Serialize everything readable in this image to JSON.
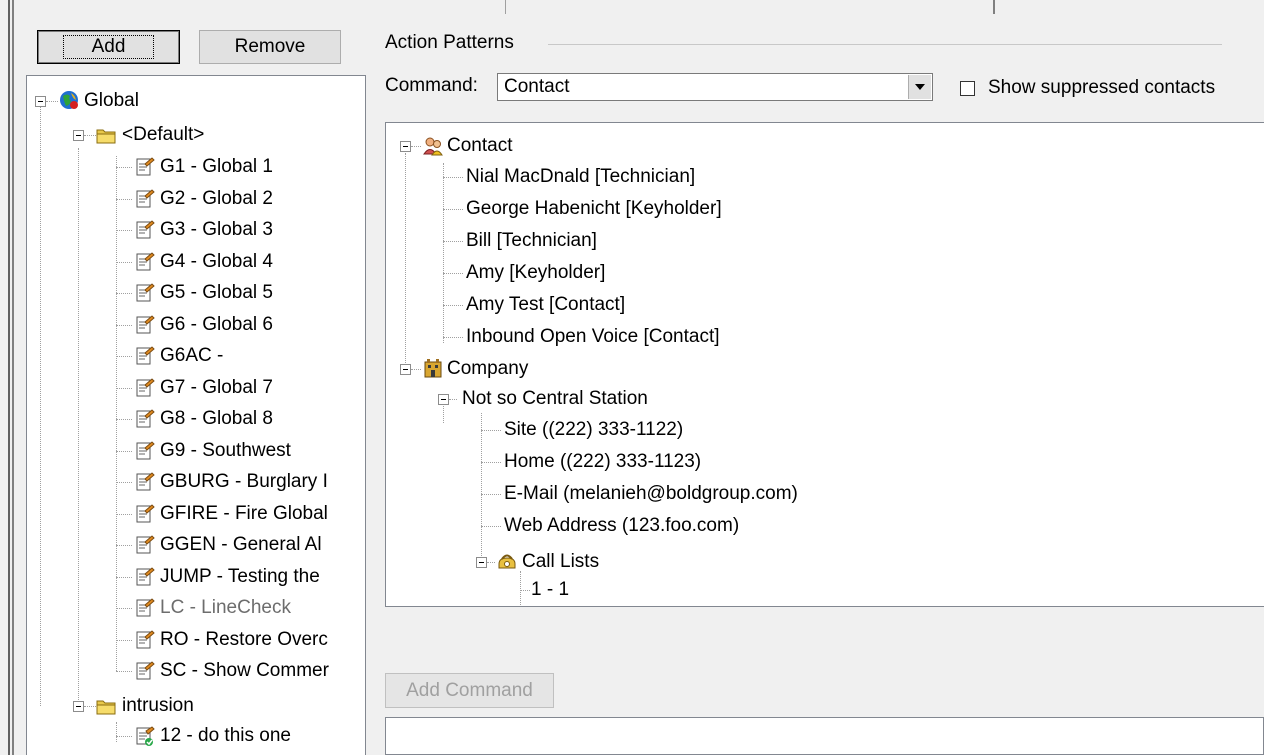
{
  "toolbar": {
    "add_label": "Add",
    "remove_label": "Remove"
  },
  "left_tree": {
    "root": "Global",
    "groups": [
      {
        "name": "<Default>",
        "items": [
          "G1 - Global 1",
          "G2 - Global 2",
          "G3 - Global 3",
          "G4 - Global 4",
          "G5 - Global 5",
          "G6 - Global 6",
          "G6AC -",
          "G7 - Global 7",
          "G8 - Global 8",
          "G9 - Southwest",
          "GBURG - Burglary I",
          "GFIRE - Fire Global",
          "GGEN - General Al",
          "JUMP - Testing the",
          "LC - LineCheck",
          "RO - Restore Overc",
          "SC - Show Commer"
        ]
      },
      {
        "name": "intrusion",
        "items": [
          "12 - do this one"
        ]
      }
    ]
  },
  "action_patterns": {
    "group_title": "Action Patterns",
    "command_label": "Command:",
    "command_value": "Contact",
    "show_suppressed_label": "Show suppressed contacts",
    "add_command_label": "Add Command"
  },
  "right_tree": {
    "contact": {
      "label": "Contact",
      "children": [
        "Nial MacDnald [Technician]",
        "George Habenicht [Keyholder]",
        "Bill [Technician]",
        "Amy [Keyholder]",
        "Amy Test [Contact]",
        "Inbound Open Voice [Contact]"
      ]
    },
    "company": {
      "label": "Company",
      "station": "Not so Central Station",
      "station_children": [
        "Site ((222) 333-1122)",
        "Home ((222) 333-1123)",
        "E-Mail (melanieh@boldgroup.com)",
        "Web Address (123.foo.com)"
      ],
      "call_lists": {
        "label": "Call Lists",
        "items": [
          "1 - 1"
        ]
      }
    }
  },
  "colors": {
    "window_bg": "#f0f0f0",
    "tree_bg": "#ffffff",
    "disabled_text": "#a0a0a0"
  }
}
